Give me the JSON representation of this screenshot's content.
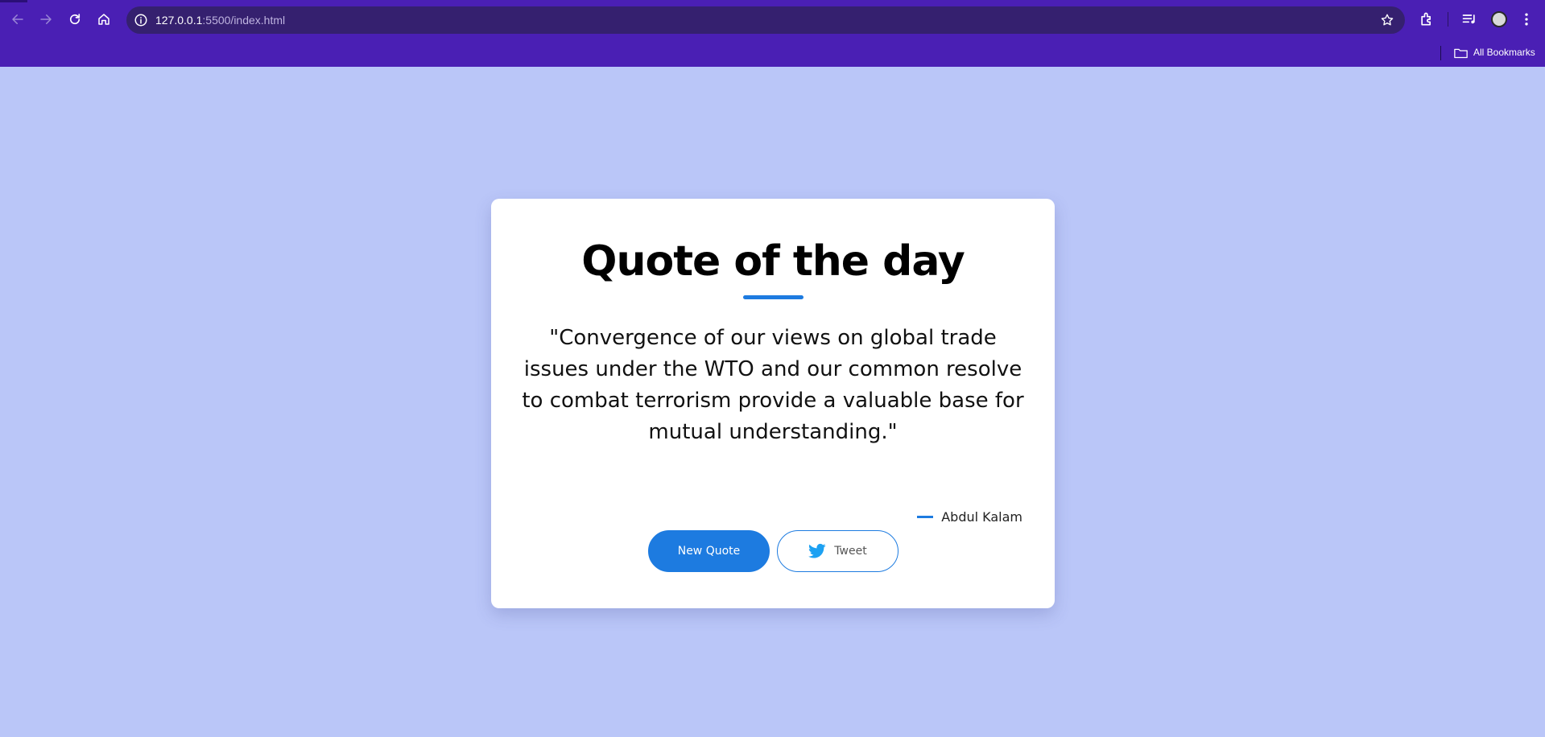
{
  "browser": {
    "url_host": "127.0.0.1",
    "url_path": ":5500/index.html",
    "bookmarks_label": "All Bookmarks",
    "icons": [
      "back-icon",
      "forward-icon",
      "reload-icon",
      "home-icon",
      "site-info-icon",
      "star-icon",
      "extensions-icon",
      "media-icon",
      "profile-avatar",
      "menu-icon",
      "folder-icon"
    ]
  },
  "page": {
    "background": "#bac6f8",
    "accent": "#1d7be0",
    "title": "Quote of the day",
    "quote": "\"Convergence of our views on global trade issues under the WTO and our common resolve to combat terrorism provide a valuable base for mutual understanding.\"",
    "author": "Abdul Kalam",
    "buttons": {
      "new_quote": "New Quote",
      "tweet": "Tweet"
    }
  }
}
